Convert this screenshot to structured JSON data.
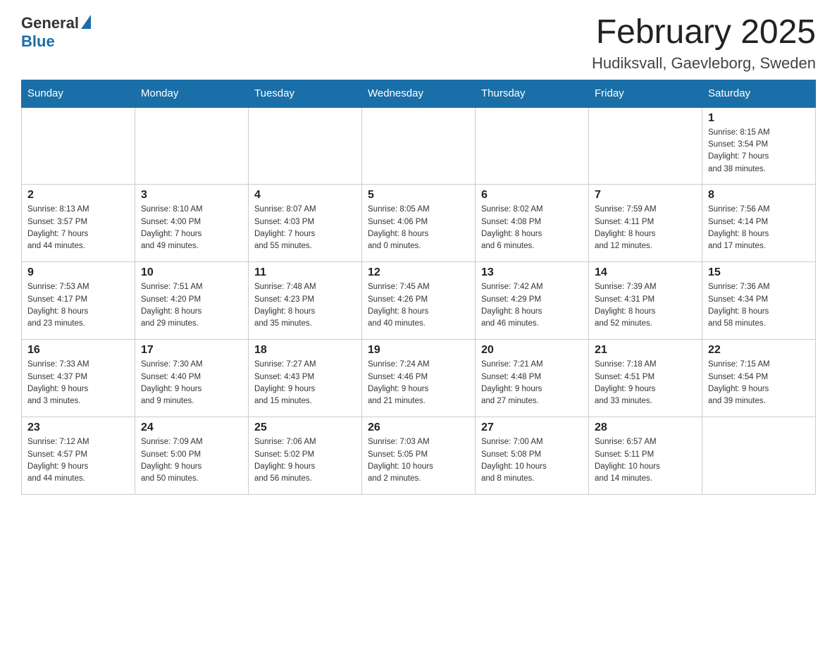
{
  "header": {
    "logo": {
      "general": "General",
      "blue": "Blue"
    },
    "title": "February 2025",
    "location": "Hudiksvall, Gaevleborg, Sweden"
  },
  "days_of_week": [
    "Sunday",
    "Monday",
    "Tuesday",
    "Wednesday",
    "Thursday",
    "Friday",
    "Saturday"
  ],
  "weeks": [
    {
      "days": [
        {
          "num": "",
          "info": ""
        },
        {
          "num": "",
          "info": ""
        },
        {
          "num": "",
          "info": ""
        },
        {
          "num": "",
          "info": ""
        },
        {
          "num": "",
          "info": ""
        },
        {
          "num": "",
          "info": ""
        },
        {
          "num": "1",
          "info": "Sunrise: 8:15 AM\nSunset: 3:54 PM\nDaylight: 7 hours\nand 38 minutes."
        }
      ]
    },
    {
      "days": [
        {
          "num": "2",
          "info": "Sunrise: 8:13 AM\nSunset: 3:57 PM\nDaylight: 7 hours\nand 44 minutes."
        },
        {
          "num": "3",
          "info": "Sunrise: 8:10 AM\nSunset: 4:00 PM\nDaylight: 7 hours\nand 49 minutes."
        },
        {
          "num": "4",
          "info": "Sunrise: 8:07 AM\nSunset: 4:03 PM\nDaylight: 7 hours\nand 55 minutes."
        },
        {
          "num": "5",
          "info": "Sunrise: 8:05 AM\nSunset: 4:06 PM\nDaylight: 8 hours\nand 0 minutes."
        },
        {
          "num": "6",
          "info": "Sunrise: 8:02 AM\nSunset: 4:08 PM\nDaylight: 8 hours\nand 6 minutes."
        },
        {
          "num": "7",
          "info": "Sunrise: 7:59 AM\nSunset: 4:11 PM\nDaylight: 8 hours\nand 12 minutes."
        },
        {
          "num": "8",
          "info": "Sunrise: 7:56 AM\nSunset: 4:14 PM\nDaylight: 8 hours\nand 17 minutes."
        }
      ]
    },
    {
      "days": [
        {
          "num": "9",
          "info": "Sunrise: 7:53 AM\nSunset: 4:17 PM\nDaylight: 8 hours\nand 23 minutes."
        },
        {
          "num": "10",
          "info": "Sunrise: 7:51 AM\nSunset: 4:20 PM\nDaylight: 8 hours\nand 29 minutes."
        },
        {
          "num": "11",
          "info": "Sunrise: 7:48 AM\nSunset: 4:23 PM\nDaylight: 8 hours\nand 35 minutes."
        },
        {
          "num": "12",
          "info": "Sunrise: 7:45 AM\nSunset: 4:26 PM\nDaylight: 8 hours\nand 40 minutes."
        },
        {
          "num": "13",
          "info": "Sunrise: 7:42 AM\nSunset: 4:29 PM\nDaylight: 8 hours\nand 46 minutes."
        },
        {
          "num": "14",
          "info": "Sunrise: 7:39 AM\nSunset: 4:31 PM\nDaylight: 8 hours\nand 52 minutes."
        },
        {
          "num": "15",
          "info": "Sunrise: 7:36 AM\nSunset: 4:34 PM\nDaylight: 8 hours\nand 58 minutes."
        }
      ]
    },
    {
      "days": [
        {
          "num": "16",
          "info": "Sunrise: 7:33 AM\nSunset: 4:37 PM\nDaylight: 9 hours\nand 3 minutes."
        },
        {
          "num": "17",
          "info": "Sunrise: 7:30 AM\nSunset: 4:40 PM\nDaylight: 9 hours\nand 9 minutes."
        },
        {
          "num": "18",
          "info": "Sunrise: 7:27 AM\nSunset: 4:43 PM\nDaylight: 9 hours\nand 15 minutes."
        },
        {
          "num": "19",
          "info": "Sunrise: 7:24 AM\nSunset: 4:46 PM\nDaylight: 9 hours\nand 21 minutes."
        },
        {
          "num": "20",
          "info": "Sunrise: 7:21 AM\nSunset: 4:48 PM\nDaylight: 9 hours\nand 27 minutes."
        },
        {
          "num": "21",
          "info": "Sunrise: 7:18 AM\nSunset: 4:51 PM\nDaylight: 9 hours\nand 33 minutes."
        },
        {
          "num": "22",
          "info": "Sunrise: 7:15 AM\nSunset: 4:54 PM\nDaylight: 9 hours\nand 39 minutes."
        }
      ]
    },
    {
      "days": [
        {
          "num": "23",
          "info": "Sunrise: 7:12 AM\nSunset: 4:57 PM\nDaylight: 9 hours\nand 44 minutes."
        },
        {
          "num": "24",
          "info": "Sunrise: 7:09 AM\nSunset: 5:00 PM\nDaylight: 9 hours\nand 50 minutes."
        },
        {
          "num": "25",
          "info": "Sunrise: 7:06 AM\nSunset: 5:02 PM\nDaylight: 9 hours\nand 56 minutes."
        },
        {
          "num": "26",
          "info": "Sunrise: 7:03 AM\nSunset: 5:05 PM\nDaylight: 10 hours\nand 2 minutes."
        },
        {
          "num": "27",
          "info": "Sunrise: 7:00 AM\nSunset: 5:08 PM\nDaylight: 10 hours\nand 8 minutes."
        },
        {
          "num": "28",
          "info": "Sunrise: 6:57 AM\nSunset: 5:11 PM\nDaylight: 10 hours\nand 14 minutes."
        },
        {
          "num": "",
          "info": ""
        }
      ]
    }
  ]
}
